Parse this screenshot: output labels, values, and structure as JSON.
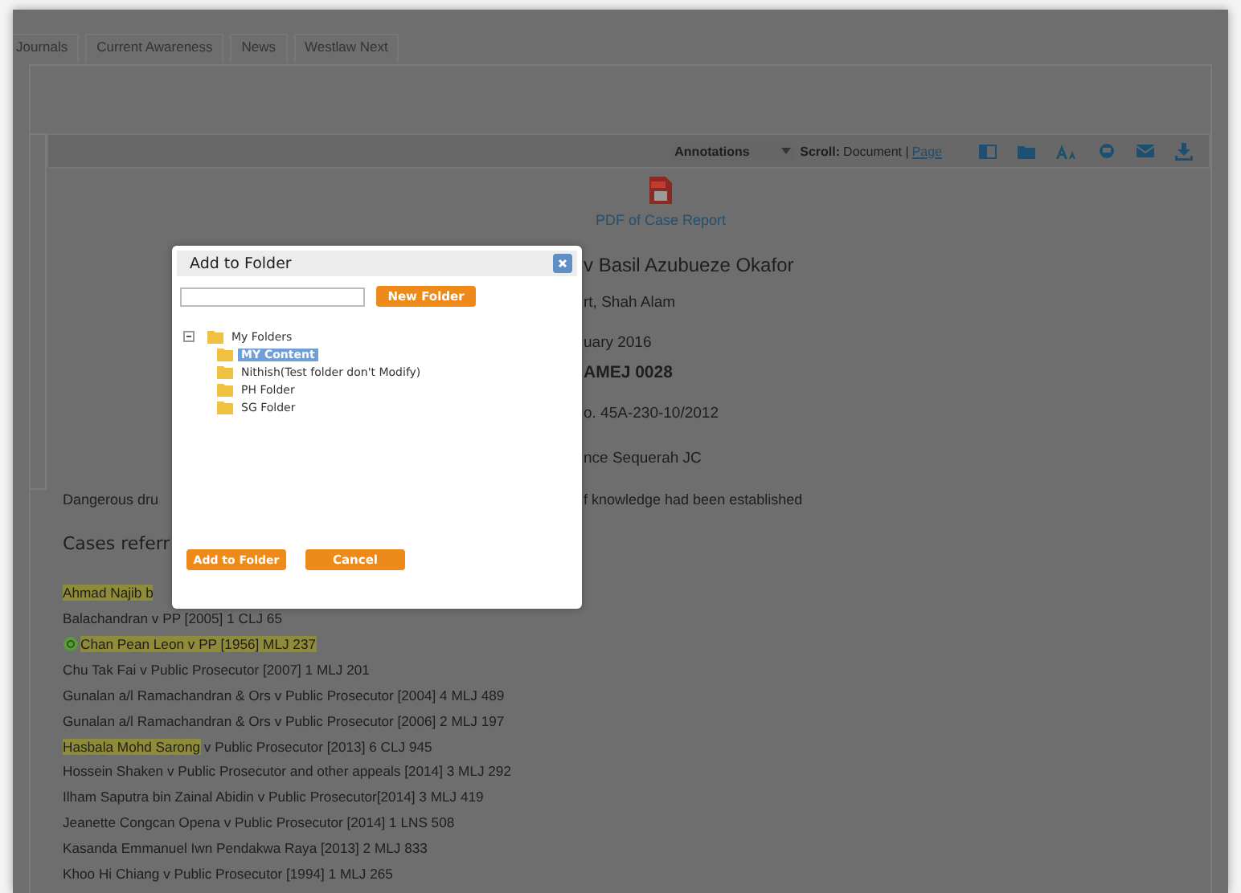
{
  "tabs": [
    {
      "label": "Journals"
    },
    {
      "label": "Current Awareness"
    },
    {
      "label": "News"
    },
    {
      "label": "Westlaw Next"
    }
  ],
  "toolbar": {
    "annotations_select": "Annotations",
    "scroll_label": "Scroll:",
    "scroll_document": "Document |",
    "scroll_page_link": "Page"
  },
  "pdf_link": "PDF of Case Report",
  "document": {
    "lines": [
      {
        "kind": "title",
        "right": "v Basil Azubueze Okafor"
      },
      {
        "kind": "meta",
        "right": "rt, Shah Alam"
      },
      {
        "kind": "meta",
        "right": "uary 2016"
      },
      {
        "kind": "bold",
        "right": "AMEJ 0028"
      },
      {
        "kind": "meta",
        "right": "o. 45A-230-10/2012"
      },
      {
        "kind": "meta",
        "right": "nce Sequerah JC"
      },
      {
        "kind": "para",
        "left": "Dangerous dru",
        "right": "f knowledge had been established"
      },
      {
        "kind": "heading",
        "left": "Cases referr"
      }
    ]
  },
  "cases": [
    {
      "highlight": "Ahmad Najib b",
      "annotated": false
    },
    {
      "text": "Balachandran v PP [2005] 1 CLJ 65",
      "annotated": false
    },
    {
      "highlight": "Chan Pean Leon v PP [1956] MLJ 237",
      "annotated": true
    },
    {
      "text": "Chu Tak Fai v Public Prosecutor [2007] 1 MLJ 201",
      "annotated": false
    },
    {
      "text": "Gunalan a/l Ramachandran & Ors v Public Prosecutor [2004] 4 MLJ 489",
      "annotated": false
    },
    {
      "text": "Gunalan a/l Ramachandran & Ors v Public Prosecutor [2006] 2 MLJ 197",
      "annotated": false
    },
    {
      "highlight": "Hasbala Mohd Sarong",
      "text": " v Public Prosecutor [2013] 6 CLJ 945",
      "annotated": false
    },
    {
      "text": "Hossein Shaken v Public Prosecutor and other appeals [2014] 3 MLJ 292",
      "annotated": false
    },
    {
      "text": "Ilham Saputra bin Zainal Abidin v Public Prosecutor[2014] 3 MLJ 419",
      "annotated": false
    },
    {
      "text": "Jeanette Congcan Opena v Public Prosecutor [2014] 1 LNS 508",
      "annotated": false
    },
    {
      "text": "Kasanda Emmanuel Iwn Pendakwa Raya [2013] 2 MLJ 833",
      "annotated": false
    },
    {
      "text": "Khoo Hi Chiang v Public Prosecutor [1994] 1 MLJ 265",
      "annotated": false
    }
  ],
  "dialog": {
    "title": "Add to Folder",
    "new_folder_button": "New Folder",
    "tree": [
      {
        "label": "My Folders",
        "expanded": true,
        "selected": false,
        "children": [
          {
            "label": "MY Content",
            "selected": true
          },
          {
            "label": "Nithish(Test folder don't Modify)",
            "selected": false
          },
          {
            "label": "PH Folder",
            "selected": false
          },
          {
            "label": "SG Folder",
            "selected": false
          }
        ]
      }
    ],
    "buttons": [
      "Add to Folder",
      "Cancel"
    ]
  }
}
